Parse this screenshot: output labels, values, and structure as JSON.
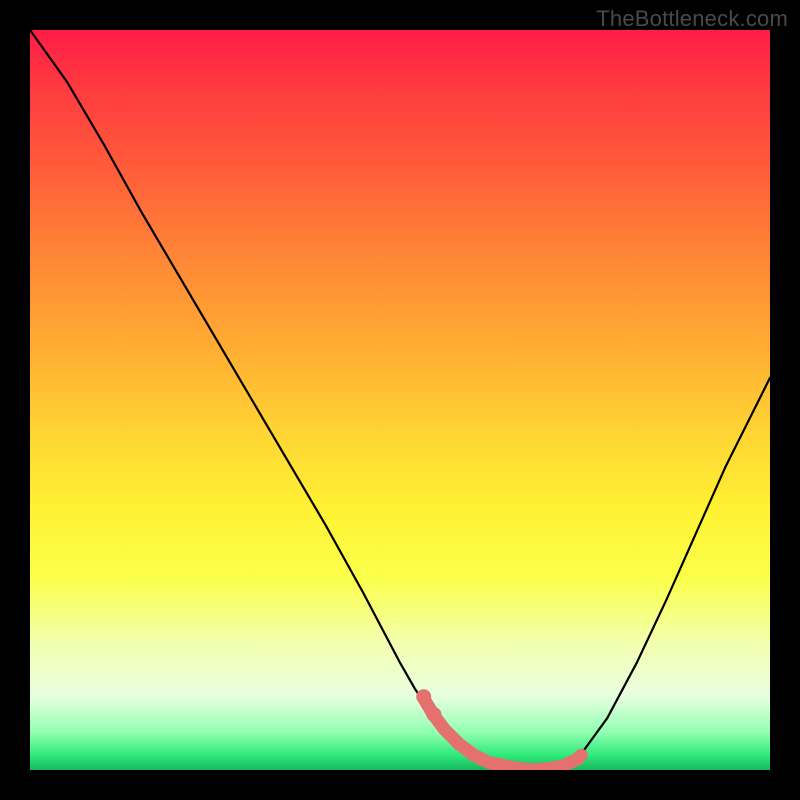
{
  "watermark": "TheBottleneck.com",
  "chart_data": {
    "type": "line",
    "title": "",
    "xlabel": "",
    "ylabel": "",
    "xlim": [
      0,
      1
    ],
    "ylim": [
      0,
      1
    ],
    "series": [
      {
        "name": "bottleneck-curve",
        "x": [
          0.0,
          0.05,
          0.1,
          0.15,
          0.2,
          0.25,
          0.3,
          0.35,
          0.4,
          0.45,
          0.5,
          0.52,
          0.54,
          0.56,
          0.58,
          0.6,
          0.64,
          0.68,
          0.72,
          0.74,
          0.78,
          0.82,
          0.86,
          0.9,
          0.94,
          1.0
        ],
        "values": [
          1.0,
          0.93,
          0.845,
          0.755,
          0.67,
          0.585,
          0.5,
          0.415,
          0.33,
          0.24,
          0.145,
          0.11,
          0.08,
          0.055,
          0.035,
          0.02,
          0.006,
          0.0,
          0.005,
          0.015,
          0.07,
          0.145,
          0.23,
          0.32,
          0.41,
          0.53
        ]
      }
    ],
    "highlight": {
      "name": "optimal-band",
      "x": [
        0.533,
        0.545,
        0.56,
        0.58,
        0.6,
        0.62,
        0.64,
        0.66,
        0.68,
        0.7,
        0.72,
        0.73,
        0.74,
        0.745
      ],
      "values": [
        0.095,
        0.075,
        0.055,
        0.035,
        0.02,
        0.01,
        0.006,
        0.002,
        0.0,
        0.002,
        0.005,
        0.01,
        0.015,
        0.02
      ]
    },
    "markers": [
      {
        "x": 0.532,
        "y": 0.099
      },
      {
        "x": 0.546,
        "y": 0.075
      }
    ],
    "gradient_colors": {
      "top": "#ff1c47",
      "bottom": "#16b85d"
    },
    "highlight_color": "#e4716d",
    "curve_color": "#000000"
  }
}
